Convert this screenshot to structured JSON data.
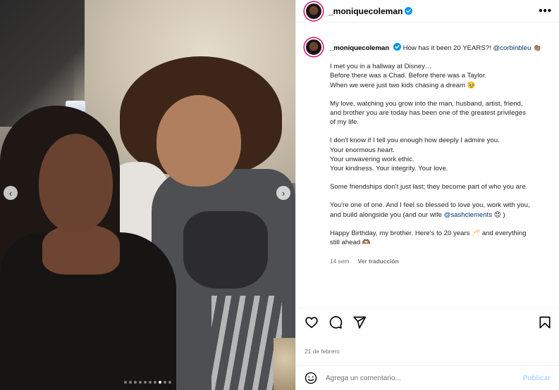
{
  "post": {
    "username": "_moniquecoleman",
    "verified": true,
    "caption_first": "How has it been 20 YEARS?!",
    "caption_mention": "@corbinbleu",
    "caption_first_emoji": "👏🏽",
    "paragraphs": [
      [
        "I met you in a hallway at Disney…",
        "Before there was a Chad. Before there was a Taylor.",
        "When we were just two kids chasing a dream 🥹"
      ],
      [
        "My love, watching you grow into the man, husband, artist, friend,",
        "and brother you are today has been one of the greatest privileges",
        "of my life."
      ],
      [
        "I don't know if I tell you enough how deeply I admire you.",
        "Your enormous heart.",
        "Your unwavering work ethic.",
        "Your kindness. Your integrity. Your love."
      ],
      [
        "Some friendships don't just last; they become part of who you are."
      ],
      [
        "You're one of one. And I feel so blessed to love you, work with you,"
      ],
      [
        "Happy Birthday, my brother. Here's to 20 years 🥂 and everything",
        "still ahead 🫶🏾"
      ]
    ],
    "wife_line_prefix": "and build alongside you (and our wife",
    "wife_mention": "@sashclements",
    "wife_line_suffix": "😍 )",
    "time_ago": "14 sem",
    "translate_label": "Ver traducción",
    "date": "21 de febrero"
  },
  "carousel": {
    "prev_icon": "chevron-left-icon",
    "next_icon": "chevron-right-icon",
    "prev_glyph": "‹",
    "next_glyph": "›",
    "dot_count": 10,
    "active_dot": 7
  },
  "comment": {
    "placeholder": "Agrega un comentario...",
    "publish_label": "Publicar"
  },
  "header": {
    "more_glyph": "•••"
  },
  "colors": {
    "story_ring": "#d3006f",
    "verified_blue": "#0095f6",
    "mention_blue": "#00376b",
    "publish_disabled": "#b3dbff",
    "muted_text": "#737373"
  }
}
